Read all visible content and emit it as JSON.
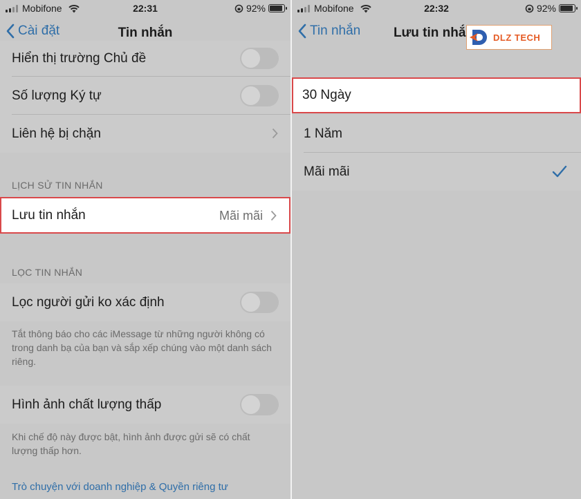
{
  "left": {
    "status": {
      "carrier": "Mobifone",
      "time": "22:31",
      "battery": "92%",
      "battery_level": 0.92
    },
    "nav": {
      "back_label": "Cài đặt",
      "title": "Tin nhắn"
    },
    "rows_top": [
      {
        "label": "Hiển thị trường Chủ đề",
        "toggle": false
      },
      {
        "label": "Số lượng Ký tự",
        "toggle": false
      },
      {
        "label": "Liên hệ bị chặn"
      }
    ],
    "history": {
      "header": "LỊCH SỬ TIN NHẮN",
      "keep_label": "Lưu tin nhắn",
      "keep_value": "Mãi mãi"
    },
    "filter": {
      "header": "LỌC TIN NHẮN",
      "unknown_label": "Lọc người gửi ko xác định",
      "unknown_note": "Tắt thông báo cho các iMessage từ những người không có trong danh bạ của bạn và sắp xếp chúng vào một danh sách riêng."
    },
    "low_quality": {
      "label": "Hình ảnh chất lượng thấp",
      "note": "Khi chế độ này được bật, hình ảnh được gửi sẽ có chất lượng thấp hơn."
    },
    "business_link": "Trò chuyện với doanh nghiệp & Quyền riêng tư"
  },
  "right": {
    "status": {
      "carrier": "Mobifone",
      "time": "22:32",
      "battery": "92%",
      "battery_level": 0.92
    },
    "nav": {
      "back_label": "Tin nhắn",
      "title": "Lưu tin nhắn"
    },
    "options": [
      {
        "label": "30 Ngày",
        "selected": false
      },
      {
        "label": "1 Năm",
        "selected": false
      },
      {
        "label": "Mãi mãi",
        "selected": true
      }
    ]
  },
  "logo": {
    "name": "DLZ TECH"
  },
  "colors": {
    "accent": "#2f6ea8",
    "highlight_border": "#d9484a",
    "logo": "#e55b25"
  }
}
